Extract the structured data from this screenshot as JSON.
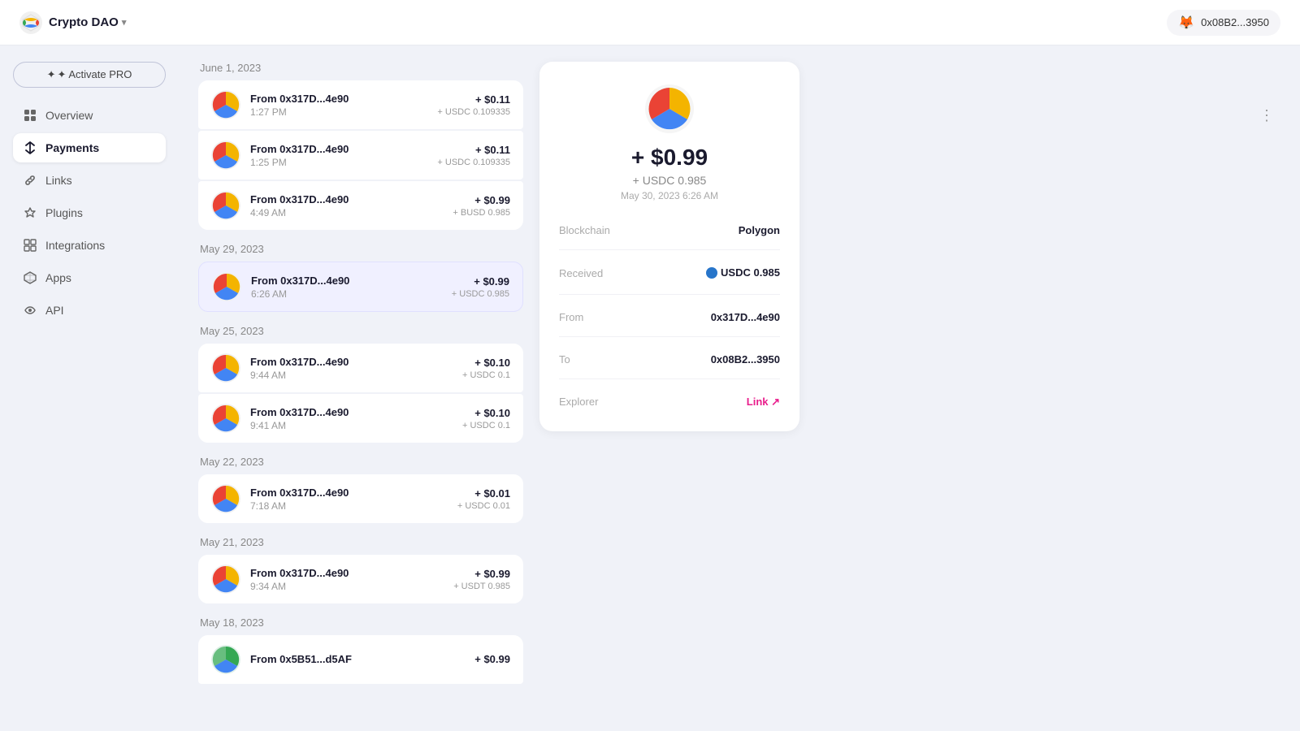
{
  "topbar": {
    "app_name": "Crypto DAO",
    "app_logo_emoji": "🌐",
    "dropdown_icon": "▾",
    "wallet_emoji": "🦊",
    "wallet_address": "0x08B2...3950"
  },
  "sidebar": {
    "activate_pro_label": "✦ Activate PRO",
    "items": [
      {
        "id": "overview",
        "label": "Overview",
        "icon": "▬",
        "active": false
      },
      {
        "id": "payments",
        "label": "Payments",
        "icon": "⟳",
        "active": true
      },
      {
        "id": "links",
        "label": "Links",
        "icon": "◇",
        "active": false
      },
      {
        "id": "plugins",
        "label": "Plugins",
        "icon": "⊕",
        "active": false
      },
      {
        "id": "integrations",
        "label": "Integrations",
        "icon": "⊞",
        "active": false
      },
      {
        "id": "apps",
        "label": "Apps",
        "icon": "◈",
        "active": false
      },
      {
        "id": "api",
        "label": "API",
        "icon": "↺",
        "active": false
      }
    ]
  },
  "payments": {
    "groups": [
      {
        "date": "June 1, 2023",
        "transactions": [
          {
            "from": "From 0x317D...4e90",
            "time": "1:27 PM",
            "usd": "+ $0.11",
            "token": "+ USDC 0.109335"
          },
          {
            "from": "From 0x317D...4e90",
            "time": "1:25 PM",
            "usd": "+ $0.11",
            "token": "+ USDC 0.109335"
          },
          {
            "from": "From 0x317D...4e90",
            "time": "4:49 AM",
            "usd": "+ $0.99",
            "token": "+ BUSD 0.985"
          }
        ]
      },
      {
        "date": "May 29, 2023",
        "transactions": [
          {
            "from": "From 0x317D...4e90",
            "time": "6:26 AM",
            "usd": "+ $0.99",
            "token": "+ USDC 0.985",
            "selected": true
          }
        ]
      },
      {
        "date": "May 25, 2023",
        "transactions": [
          {
            "from": "From 0x317D...4e90",
            "time": "9:44 AM",
            "usd": "+ $0.10",
            "token": "+ USDC 0.1"
          },
          {
            "from": "From 0x317D...4e90",
            "time": "9:41 AM",
            "usd": "+ $0.10",
            "token": "+ USDC 0.1"
          }
        ]
      },
      {
        "date": "May 22, 2023",
        "transactions": [
          {
            "from": "From 0x317D...4e90",
            "time": "7:18 AM",
            "usd": "+ $0.01",
            "token": "+ USDC 0.01"
          }
        ]
      },
      {
        "date": "May 21, 2023",
        "transactions": [
          {
            "from": "From 0x317D...4e90",
            "time": "9:34 AM",
            "usd": "+ $0.99",
            "token": "+ USDT 0.985"
          }
        ]
      },
      {
        "date": "May 18, 2023",
        "transactions": [
          {
            "from": "From 0x5B51...d5AF",
            "time": "",
            "usd": "+ $0.99",
            "token": ""
          }
        ]
      }
    ]
  },
  "detail": {
    "amount": "+ $0.99",
    "token": "+ USDC 0.985",
    "date": "May 30, 2023 6:26 AM",
    "blockchain_label": "Blockchain",
    "blockchain_value": "Polygon",
    "received_label": "Received",
    "received_value": "USDC 0.985",
    "from_label": "From",
    "from_value": "0x317D...4e90",
    "to_label": "To",
    "to_value": "0x08B2...3950",
    "explorer_label": "Explorer",
    "explorer_value": "Link ↗"
  },
  "more_btn": "⋮"
}
